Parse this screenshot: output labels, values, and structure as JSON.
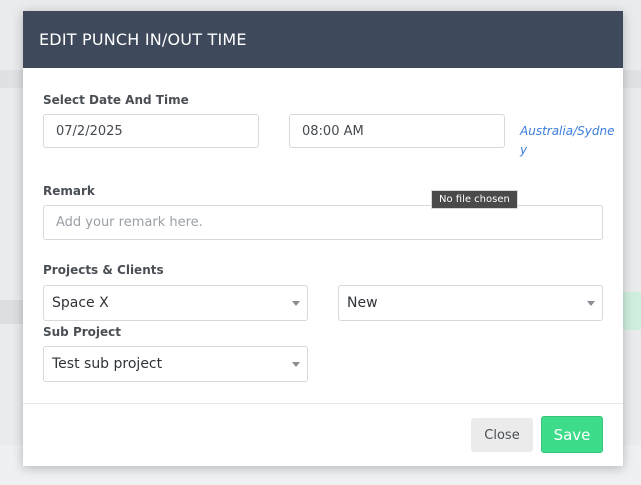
{
  "modal": {
    "title": "EDIT PUNCH IN/OUT TIME",
    "date_time": {
      "label": "Select Date And Time",
      "date_value": "07/2/2025",
      "time_value": "08:00 AM",
      "timezone": "Australia/Sydney"
    },
    "remark": {
      "label": "Remark",
      "placeholder": "Add your remark here.",
      "tooltip": "No file chosen"
    },
    "projects": {
      "label": "Projects & Clients",
      "project_value": "Space X",
      "client_value": "New"
    },
    "sub_project": {
      "label": "Sub Project",
      "value": "Test sub project"
    },
    "footer": {
      "close_label": "Close",
      "save_label": "Save"
    }
  },
  "colors": {
    "header_bg": "#3e4a5b",
    "save_button": "#3ddc8a",
    "link": "#3b7de0"
  }
}
